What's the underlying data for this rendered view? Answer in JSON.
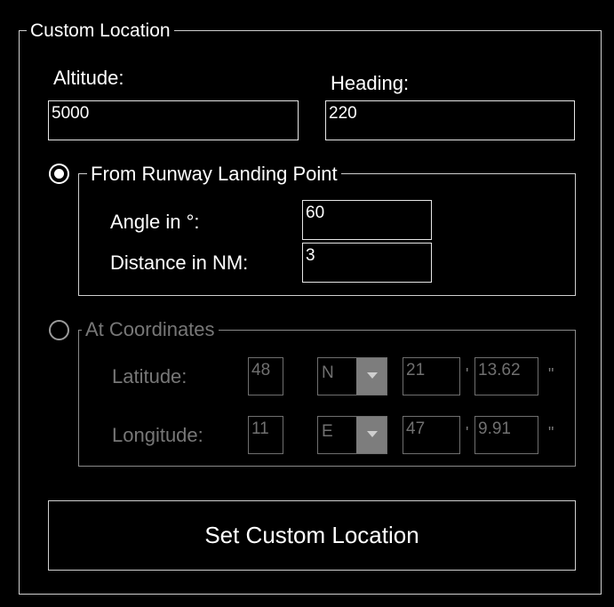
{
  "panel": {
    "title": "Custom Location"
  },
  "altitude": {
    "label": "Altitude:",
    "value": "5000"
  },
  "heading": {
    "label": "Heading:",
    "value": "220"
  },
  "from_runway": {
    "label": "From Runway Landing Point",
    "selected": true,
    "angle": {
      "label": "Angle in °:",
      "value": "60"
    },
    "distance": {
      "label": "Distance in NM:",
      "value": "3"
    }
  },
  "coordinates": {
    "label": "At Coordinates",
    "selected": false,
    "latitude": {
      "label": "Latitude:",
      "degrees": "48",
      "hemisphere": "N",
      "minutes": "21",
      "seconds": "13.62"
    },
    "longitude": {
      "label": "Longitude:",
      "degrees": "11",
      "hemisphere": "E",
      "minutes": "47",
      "seconds": "9.91"
    },
    "minute_mark": "'",
    "second_mark": "\""
  },
  "set_button": {
    "label": "Set Custom Location"
  },
  "icons": {
    "dropdown": "chevron-down-icon",
    "radio": "radio-button-icon"
  },
  "colors": {
    "background": "#000000",
    "border": "#cfcfcf",
    "disabled": "#777777"
  }
}
